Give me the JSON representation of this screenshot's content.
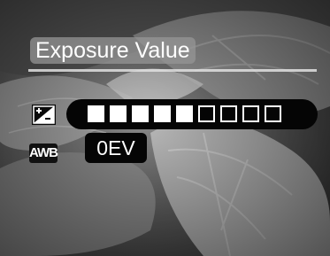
{
  "screen": {
    "title": "Exposure Value",
    "exposure": {
      "value_label": "0EV",
      "slider": {
        "total_segments": 9,
        "filled_segments": 5
      }
    },
    "white_balance_icon_text": "AWB"
  },
  "icons": {
    "exposure": "exposure-compensation-icon",
    "white_balance": "awb-icon"
  },
  "colors": {
    "overlay_bg": "#050505",
    "overlay_fg": "#ffffff",
    "title_bg": "#969696"
  }
}
